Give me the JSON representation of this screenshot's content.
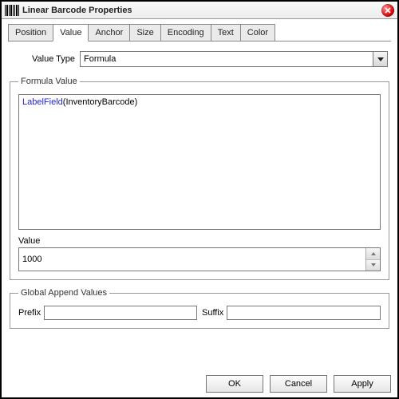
{
  "window": {
    "title": "Linear Barcode Properties"
  },
  "tabs": {
    "items": [
      {
        "label": "Position"
      },
      {
        "label": "Value"
      },
      {
        "label": "Anchor"
      },
      {
        "label": "Size"
      },
      {
        "label": "Encoding"
      },
      {
        "label": "Text"
      },
      {
        "label": "Color"
      }
    ],
    "active_index": 1
  },
  "valueType": {
    "label": "Value Type",
    "selected": "Formula"
  },
  "formula": {
    "legend": "Formula Value",
    "function": "LabelField",
    "argument": "InventoryBarcode",
    "valueLabel": "Value",
    "value": "1000"
  },
  "append": {
    "legend": "Global Append Values",
    "prefixLabel": "Prefix",
    "prefix": "",
    "suffixLabel": "Suffix",
    "suffix": ""
  },
  "buttons": {
    "ok": "OK",
    "cancel": "Cancel",
    "apply": "Apply"
  }
}
